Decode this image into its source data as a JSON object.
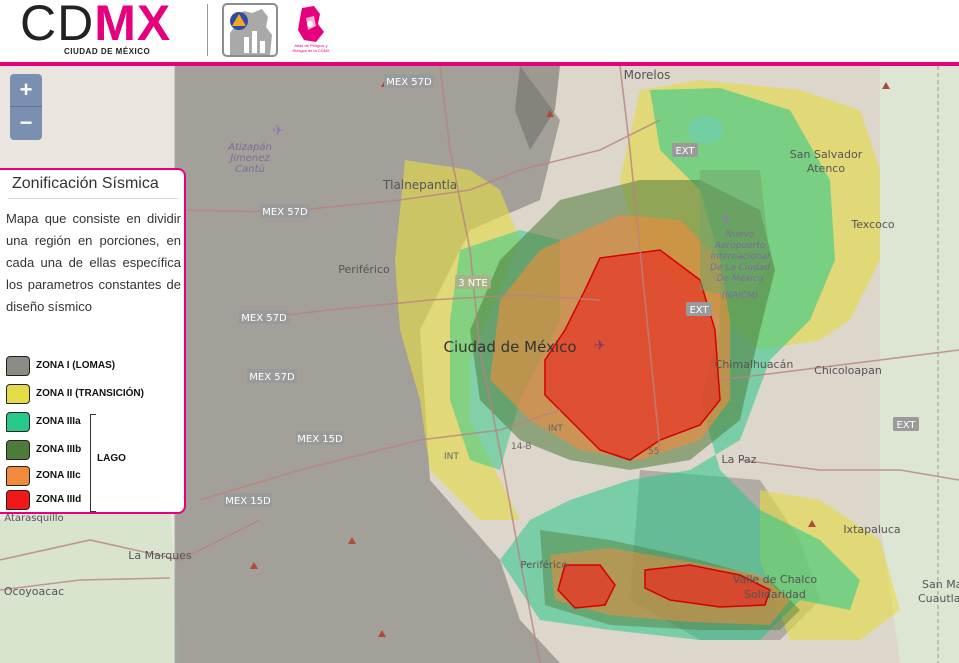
{
  "header": {
    "logo_cd": "CD",
    "logo_mx": "MX",
    "logo_subtitle": "CIUDAD DE MÉXICO",
    "atlas_text": "Atlas de Peligros y Riesgos de la CDMX"
  },
  "zoom": {
    "zoom_in": "+",
    "zoom_out": "−"
  },
  "panel": {
    "title": "Zonificación Sísmica",
    "description": "Mapa que consiste en dividir una región en porciones, en cada una de ellas específica los parametros constantes de diseño sísmico",
    "legend": [
      {
        "label": "ZONA I (LOMAS)",
        "color": "#8c8c86"
      },
      {
        "label": "ZONA II (TRANSICIÓN)",
        "color": "#e3dc45"
      },
      {
        "label": "ZONA IIIa",
        "color": "#26c98a"
      },
      {
        "label": "ZONA IIIb",
        "color": "#4f7b3a"
      },
      {
        "label": "ZONA IIIc",
        "color": "#f08a3c"
      },
      {
        "label": "ZONA IIId",
        "color": "#f01818"
      }
    ],
    "group_label": "LAGO"
  },
  "map_labels": {
    "morelos": "Morelos",
    "atizapan": "Atizapán",
    "jimenez": "Jimenez",
    "cantu": "Cantú",
    "tlalnepantla": "Tlalnepantla",
    "san_salvador": "San Salvador",
    "atenco": "Atenco",
    "texcoco": "Texcoco",
    "nuevo_aeropuerto": "Nuevo",
    "aeropuerto": "Aeropuerto",
    "internacional": "Internacional",
    "de_la_ciudad": "De La Ciudad",
    "de_mexico": "De México",
    "naicm": "(NAICM)",
    "ciudad_de_mexico": "Ciudad de México",
    "periferico_n": "Periférico",
    "chimalhuacan": "Chimalhuacán",
    "chicoloapan": "Chicoloapan",
    "la_paz": "La Paz",
    "ixtapaluca": "Ixtapaluca",
    "valle_chalco": "Valle de Chalco",
    "solidaridad": "Solidaridad",
    "periferico_s": "Periférico",
    "la_marques": "La Marques",
    "ocoyoacac": "Ocoyoacac",
    "atarasquillo": "Atarasquillo",
    "san_ma": "San Ma",
    "cuautla": "Cuautla",
    "mex57d_top": "MEX 57D",
    "mex57d_left": "MEX 57D",
    "mex57d_mid": "MEX 57D",
    "mex57d_low": "MEX 57D",
    "mex15d_a": "MEX 15D",
    "mex15d_b": "MEX 15D",
    "ext_ne": "EXT",
    "ext_mid": "EXT",
    "ext_e": "EXT",
    "nte3": "3 NTE",
    "int_a": "INT",
    "int_b": "INT",
    "int_c": "INT",
    "num_14b": "14-B",
    "num_55": "55"
  }
}
